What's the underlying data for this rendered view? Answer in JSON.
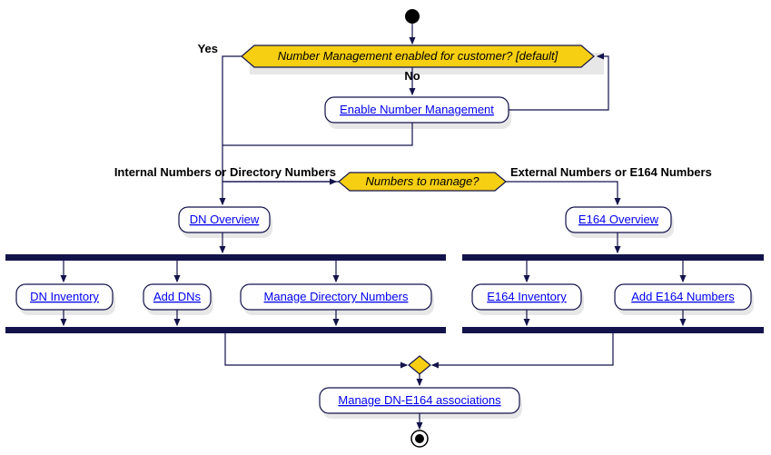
{
  "chart_data": {
    "type": "activity-diagram",
    "title": "",
    "start": true,
    "decisions": [
      {
        "id": "d1",
        "text": "Number Management enabled for customer? [default]",
        "branches": [
          {
            "label": "Yes",
            "next": "d2"
          },
          {
            "label": "No",
            "next": "enable"
          }
        ]
      },
      {
        "id": "d2",
        "text": "Numbers to manage?",
        "branches": [
          {
            "label": "Internal Numbers or Directory Numbers",
            "next": "dn_overview"
          },
          {
            "label": "External Numbers or E164 Numbers",
            "next": "e164_overview"
          }
        ]
      }
    ],
    "activities": {
      "enable": "Enable Number Management",
      "dn_overview": "DN Overview",
      "e164_overview": "E164 Overview",
      "dn_inventory": "DN Inventory",
      "add_dns": "Add DNs",
      "manage_dn": "Manage Directory Numbers",
      "e164_inventory": "E164 Inventory",
      "add_e164": "Add E164 Numbers",
      "associations": "Manage DN-E164 associations"
    },
    "forks": [
      {
        "after": "dn_overview",
        "parallel": [
          "dn_inventory",
          "add_dns",
          "manage_dn"
        ]
      },
      {
        "after": "e164_overview",
        "parallel": [
          "e164_inventory",
          "add_e164"
        ]
      }
    ],
    "merge_into": "associations",
    "end": true
  },
  "labels": {
    "yes": "Yes",
    "no": "No",
    "internal": "Internal Numbers or Directory Numbers",
    "external": "External Numbers or E164 Numbers"
  }
}
